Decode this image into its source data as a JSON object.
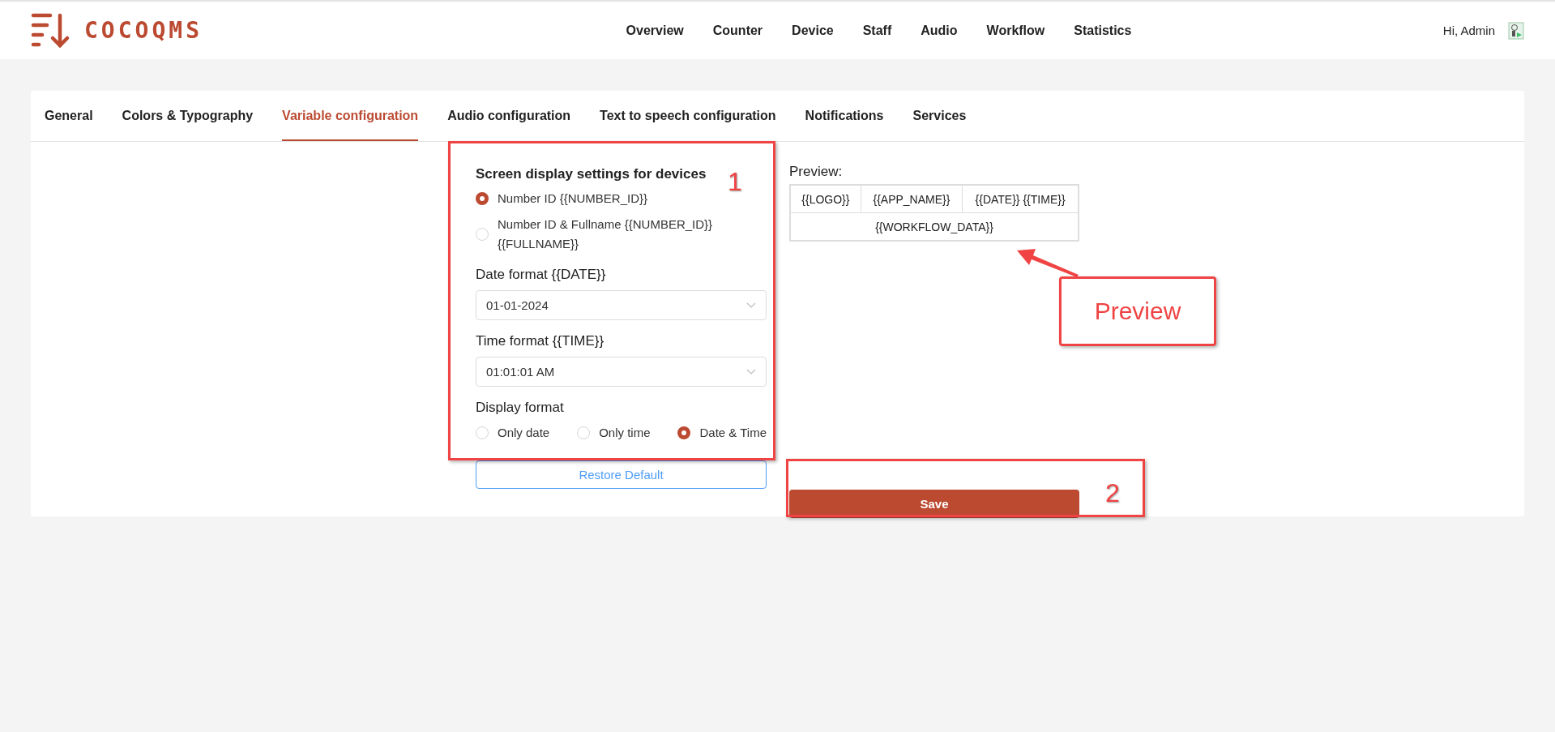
{
  "header": {
    "brand": "COCOQMS",
    "nav": [
      {
        "label": "Overview"
      },
      {
        "label": "Counter"
      },
      {
        "label": "Device"
      },
      {
        "label": "Staff"
      },
      {
        "label": "Audio"
      },
      {
        "label": "Workflow"
      },
      {
        "label": "Statistics"
      }
    ],
    "greeting": "Hi, Admin"
  },
  "tabs": [
    {
      "label": "General",
      "selected": false
    },
    {
      "label": "Colors & Typography",
      "selected": false
    },
    {
      "label": "Variable configuration",
      "selected": true
    },
    {
      "label": "Audio configuration",
      "selected": false
    },
    {
      "label": "Text to speech configuration",
      "selected": false
    },
    {
      "label": "Notifications",
      "selected": false
    },
    {
      "label": "Services",
      "selected": false
    }
  ],
  "form": {
    "heading": "Screen display settings for devices",
    "display_options": [
      {
        "label": "Number ID {{NUMBER_ID}}",
        "selected": true
      },
      {
        "label": "Number ID & Fullname {{NUMBER_ID}} {{FULLNAME}}",
        "selected": false
      }
    ],
    "date_format": {
      "label": "Date format {{DATE}}",
      "value": "01-01-2024"
    },
    "time_format": {
      "label": "Time format {{TIME}}",
      "value": "01:01:01 AM"
    },
    "display_format": {
      "label": "Display format",
      "options": [
        {
          "label": "Only date",
          "selected": false
        },
        {
          "label": "Only time",
          "selected": false
        },
        {
          "label": "Date & Time",
          "selected": true
        }
      ]
    },
    "restore_button": "Restore Default"
  },
  "preview": {
    "label": "Preview:",
    "row_1": [
      "{{LOGO}}",
      "{{APP_NAME}}",
      "{{DATE}} {{TIME}}"
    ],
    "row_2": "{{WORKFLOW_DATA}}",
    "save_button": "Save"
  },
  "annotations": {
    "marker_1": "1",
    "marker_2": "2",
    "callout": "Preview"
  }
}
